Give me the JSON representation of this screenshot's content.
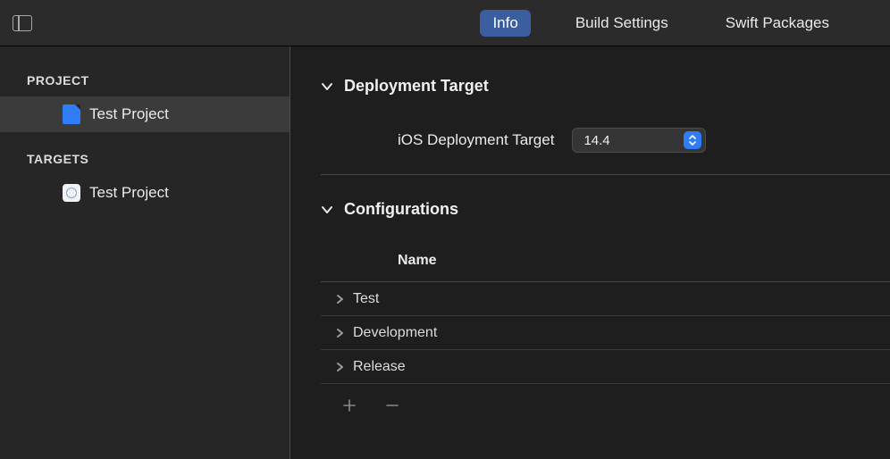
{
  "tabs": {
    "info": "Info",
    "build_settings": "Build Settings",
    "swift_packages": "Swift Packages"
  },
  "sidebar": {
    "project_label": "PROJECT",
    "targets_label": "TARGETS",
    "project_item": "Test Project",
    "target_item": "Test Project"
  },
  "sections": {
    "deployment": {
      "title": "Deployment Target",
      "field_label": "iOS Deployment Target",
      "value": "14.4"
    },
    "configurations": {
      "title": "Configurations",
      "column_header": "Name",
      "rows": [
        "Test",
        "Development",
        "Release"
      ]
    }
  }
}
